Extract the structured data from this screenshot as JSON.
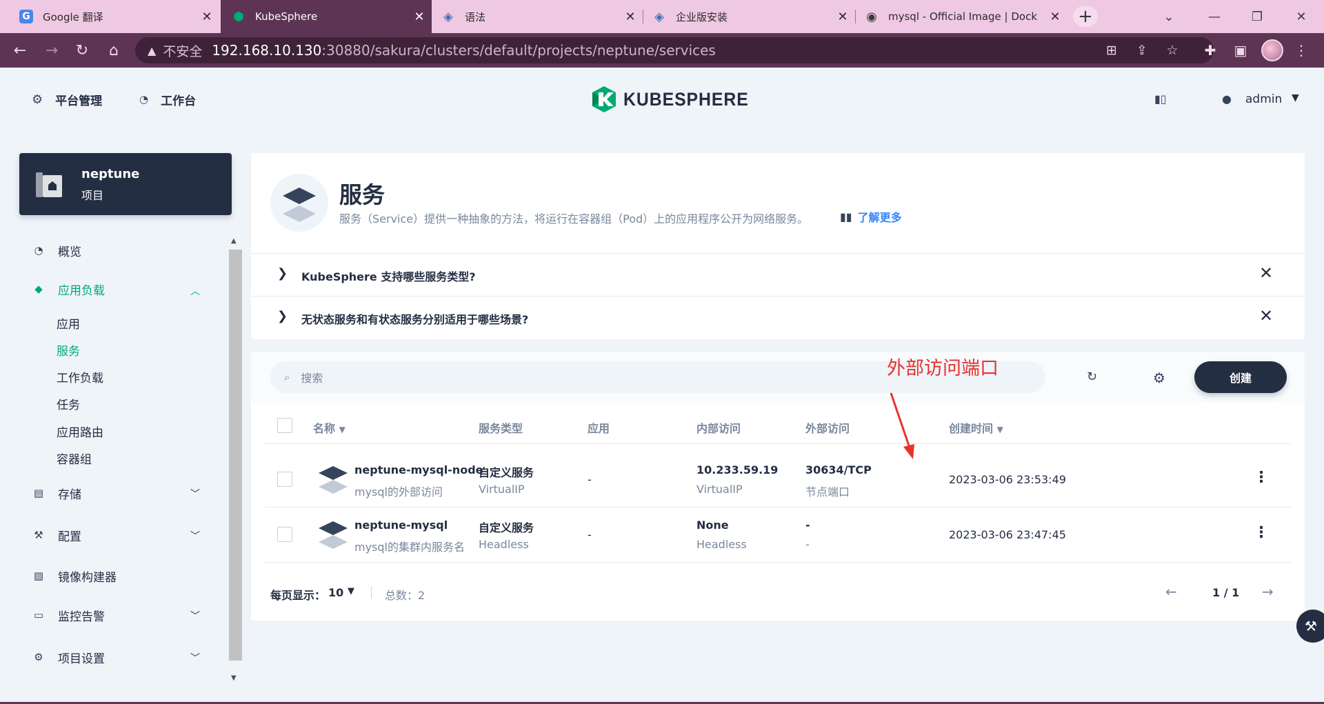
{
  "browser": {
    "tabs": [
      {
        "title": "Google 翻译",
        "icon": "google-translate-icon"
      },
      {
        "title": "KubeSphere",
        "icon": "kubesphere-icon"
      },
      {
        "title": "语法",
        "icon": "kubesphere-docs-icon"
      },
      {
        "title": "企业版安装",
        "icon": "kubesphere-docs-icon"
      },
      {
        "title": "mysql - Official Image | Dock",
        "icon": "docker-icon"
      }
    ],
    "active_tab": 1,
    "new_tab_label": "+",
    "address": {
      "security_label": "不安全",
      "host": "192.168.10.130",
      "path": ":30880/sakura/clusters/default/projects/neptune/services"
    }
  },
  "topnav": {
    "platform_label": "平台管理",
    "workbench_label": "工作台",
    "logo_text": "KUBESPHERE",
    "user_name": "admin"
  },
  "sidebar": {
    "project": {
      "name": "neptune",
      "type": "项目"
    },
    "items": [
      {
        "label": "概览",
        "icon": "dashboard-icon"
      },
      {
        "label": "应用负载",
        "icon": "appcenter-icon",
        "expanded": true
      },
      {
        "label": "存储",
        "icon": "storage-icon"
      },
      {
        "label": "配置",
        "icon": "hammer-icon"
      },
      {
        "label": "镜像构建器",
        "icon": "image-builder-icon"
      },
      {
        "label": "监控告警",
        "icon": "monitor-icon"
      },
      {
        "label": "项目设置",
        "icon": "gear-icon"
      }
    ],
    "subitems": [
      "应用",
      "服务",
      "工作负载",
      "任务",
      "应用路由",
      "容器组"
    ],
    "active_subitem": "服务"
  },
  "page": {
    "title": "服务",
    "description": "服务（Service）提供一种抽象的方法，将运行在容器组（Pod）上的应用程序公开为网络服务。",
    "learn_more": "了解更多",
    "faqs": [
      "KubeSphere 支持哪些服务类型?",
      "无状态服务和有状态服务分别适用于哪些场景?"
    ]
  },
  "table": {
    "search_placeholder": "搜索",
    "create_label": "创建",
    "columns": [
      "名称",
      "服务类型",
      "应用",
      "内部访问",
      "外部访问",
      "创建时间"
    ],
    "rows": [
      {
        "name": "neptune-mysql-node",
        "description": "mysql的外部访问",
        "type": "自定义服务",
        "type_sub": "VirtualIP",
        "app": "-",
        "internal": "10.233.59.19",
        "internal_sub": "VirtualIP",
        "external": "30634/TCP",
        "external_sub": "节点端口",
        "created": "2023-03-06 23:53:49"
      },
      {
        "name": "neptune-mysql",
        "description": "mysql的集群内服务名",
        "type": "自定义服务",
        "type_sub": "Headless",
        "app": "-",
        "internal": "None",
        "internal_sub": "Headless",
        "external": "-",
        "external_sub": "-",
        "created": "2023-03-06 23:47:45"
      }
    ],
    "pagination": {
      "per_page_label": "每页显示：",
      "per_page": "10",
      "total_label": "总数：2",
      "page": "1 / 1"
    }
  },
  "annotation": {
    "text": "外部访问端口",
    "color": "#e8322c"
  },
  "colors": {
    "accent": "#00aa72",
    "dark": "#242e42",
    "browser": "#5d3454"
  }
}
